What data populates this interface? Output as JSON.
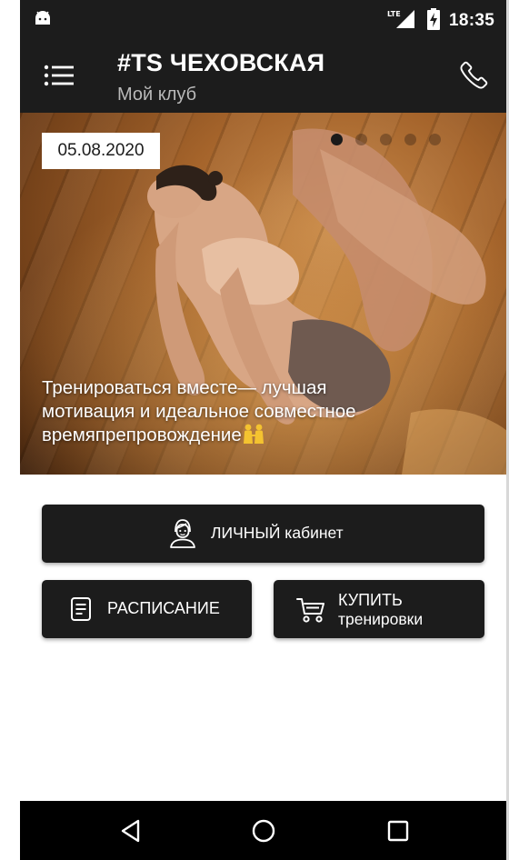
{
  "status_bar": {
    "time": "18:35",
    "network": "LTE",
    "icons": [
      "android-icon",
      "lte-signal-icon",
      "battery-charging-icon"
    ]
  },
  "app_bar": {
    "title": "#TS ЧЕХОВСКАЯ",
    "subtitle": "Мой клуб",
    "icons": [
      "menu-icon",
      "phone-icon"
    ]
  },
  "banner": {
    "date": "05.08.2020",
    "caption": "Тренироваться вместе— лучшая\nмотивация и идеальное совместное\nвремяпрепровождение",
    "caption_emoji": "people-holding-hands-emoji",
    "slides_total": 5,
    "active_slide": 1
  },
  "actions": {
    "cabinet_label": "ЛИЧНЫЙ кабинет",
    "schedule_label": "РАСПИСАНИЕ",
    "buy_label_line1": "КУПИТЬ",
    "buy_label_line2": "тренировки"
  },
  "nav_bar": {
    "icons": [
      "back-icon",
      "home-icon",
      "recent-apps-icon"
    ]
  },
  "colors": {
    "bar_background": "#1c1c1c",
    "button_background": "#1c1c1c",
    "nav_background": "#000000",
    "text_on_dark": "#ffffff",
    "subtitle": "#b9b9b9"
  }
}
